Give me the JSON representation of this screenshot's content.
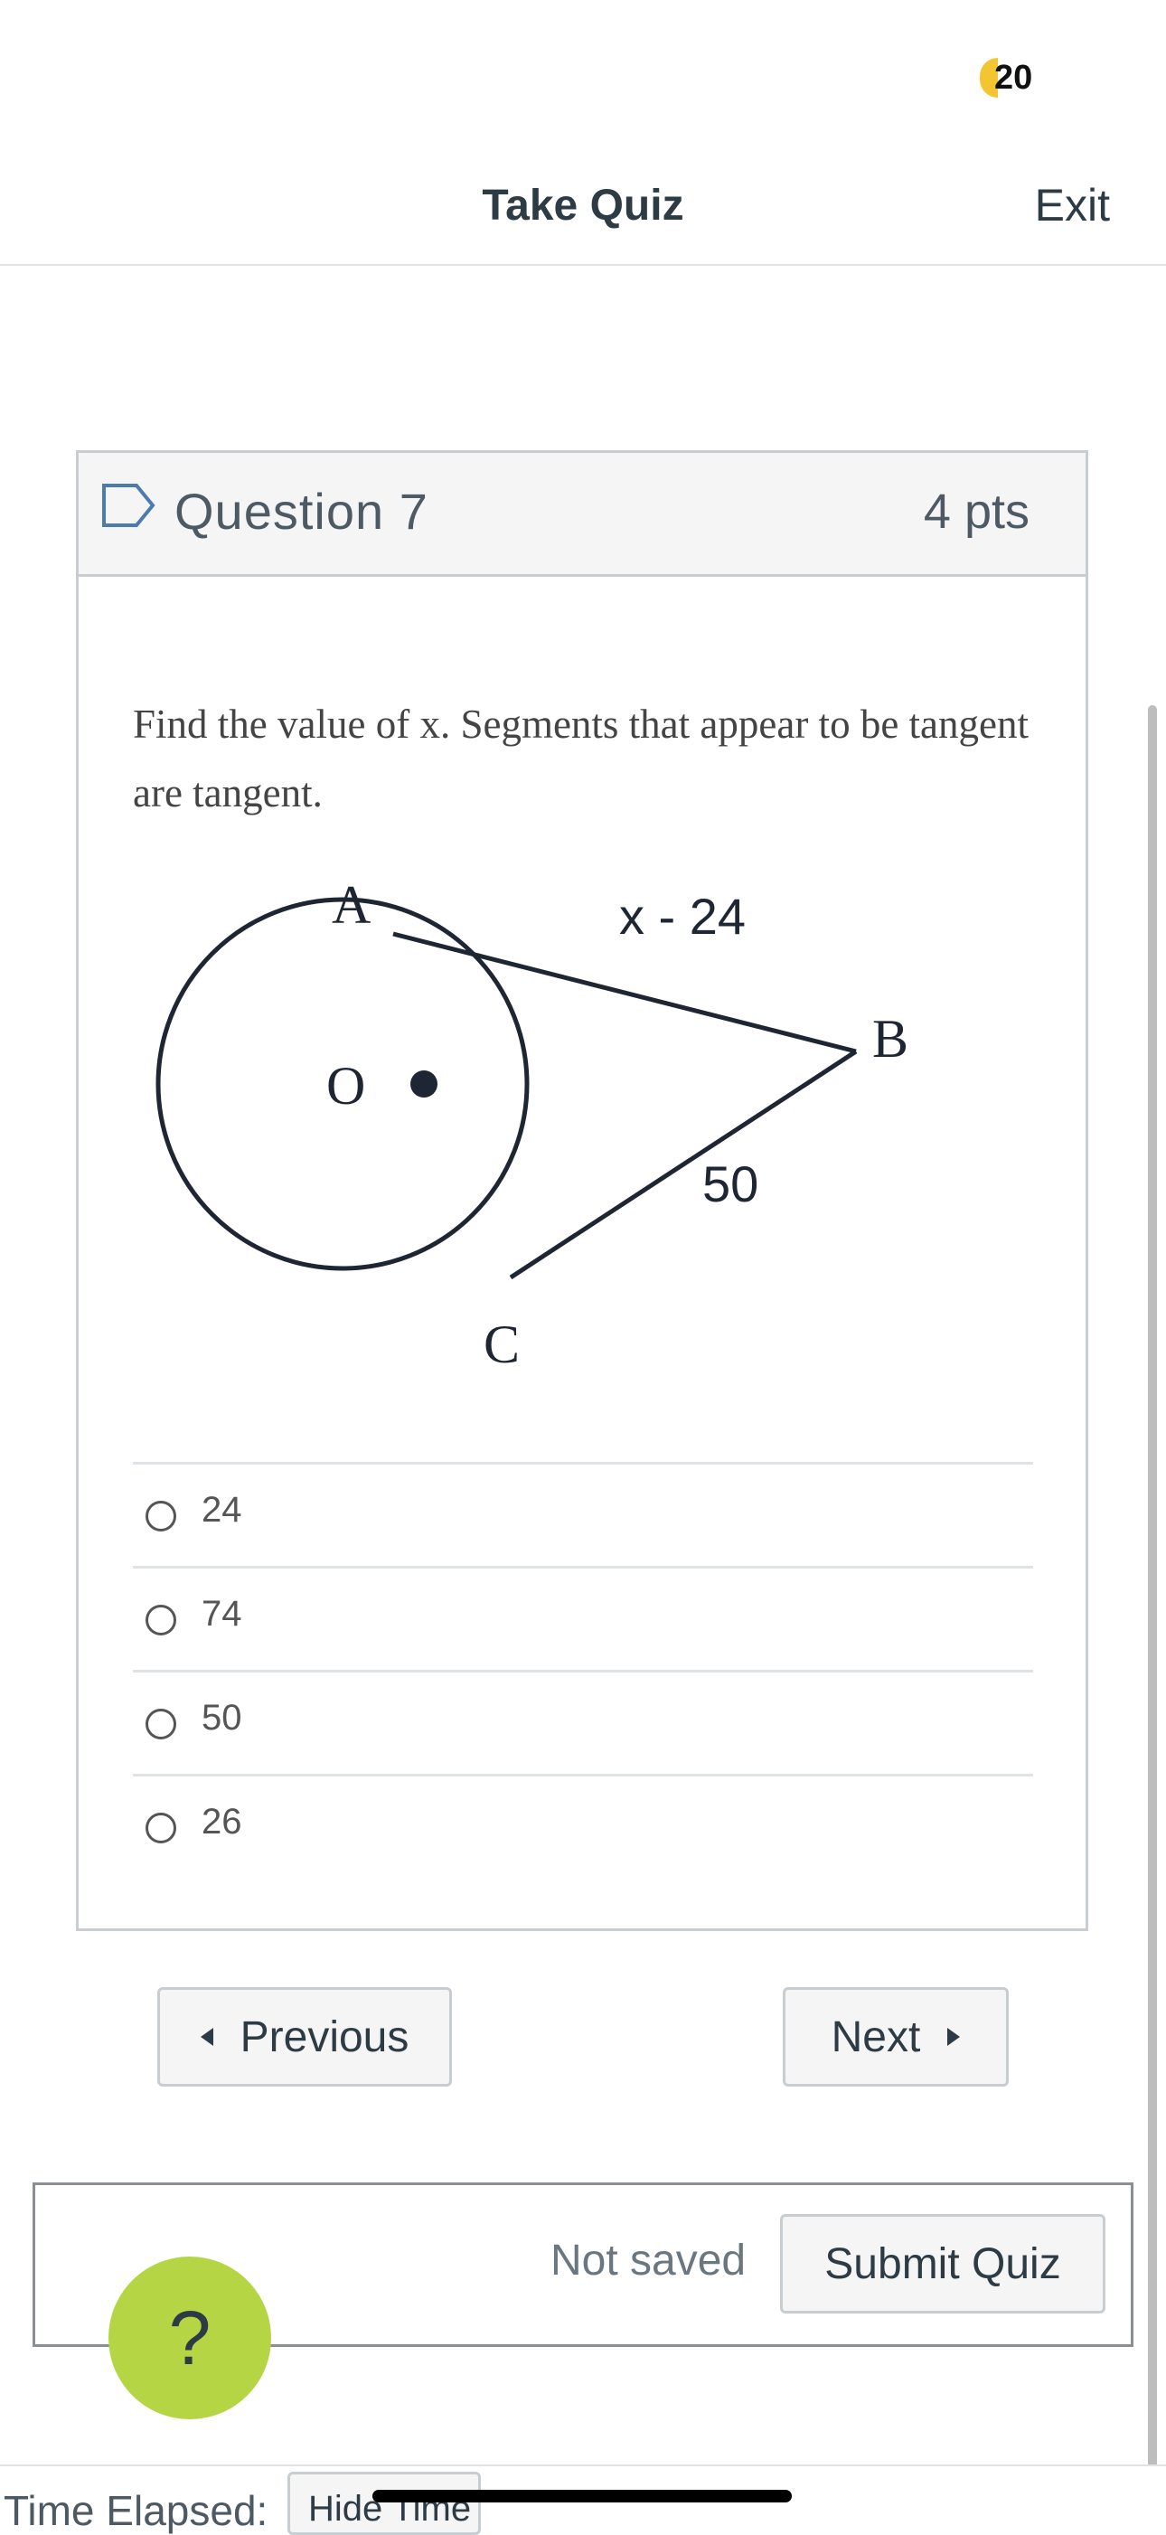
{
  "status": {
    "badge_count": "20"
  },
  "header": {
    "title": "Take Quiz",
    "exit_label": "Exit"
  },
  "question": {
    "title": "Question 7",
    "points": "4 pts",
    "prompt": "Find the value of x. Segments that appear to be tangent are tangent.",
    "diagram": {
      "point_a": "A",
      "point_b": "B",
      "point_c": "C",
      "center": "O",
      "label_ab": "x - 24",
      "label_cb": "50"
    },
    "answers": [
      {
        "label": "24"
      },
      {
        "label": "74"
      },
      {
        "label": "50"
      },
      {
        "label": "26"
      }
    ]
  },
  "navigation": {
    "previous_label": "Previous",
    "next_label": "Next"
  },
  "submit": {
    "status": "Not saved",
    "button_label": "Submit Quiz"
  },
  "help": {
    "label": "?"
  },
  "footer": {
    "elapsed_label": "Time Elapsed:",
    "hide_time_label": "Hide Time"
  },
  "colors": {
    "help_green": "#b6d544",
    "badge_yellow": "#f3c530",
    "text_dark": "#2d3b45"
  }
}
